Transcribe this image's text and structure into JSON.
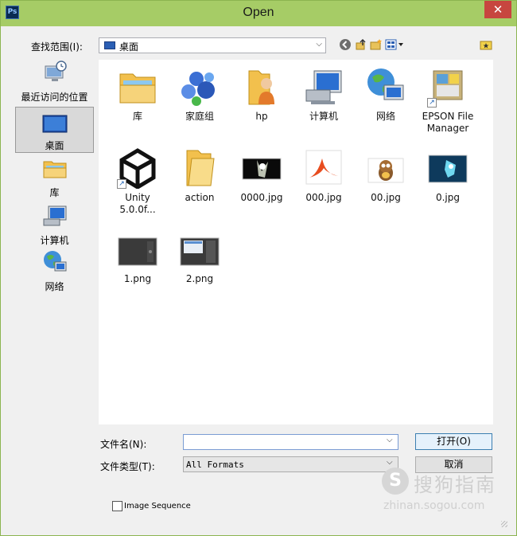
{
  "window": {
    "title": "Open",
    "app_icon": "Ps",
    "close_glyph": "✕"
  },
  "lookin": {
    "label": "查找范围(I):",
    "value": "桌面"
  },
  "sidebar": {
    "items": [
      {
        "label": "最近访问的位置",
        "icon": "recent-places-icon"
      },
      {
        "label": "桌面",
        "icon": "desktop-icon",
        "selected": true
      },
      {
        "label": "库",
        "icon": "libraries-icon"
      },
      {
        "label": "计算机",
        "icon": "computer-icon"
      },
      {
        "label": "网络",
        "icon": "network-icon"
      }
    ]
  },
  "files": [
    {
      "name": "库",
      "icon": "libraries-icon"
    },
    {
      "name": "家庭组",
      "icon": "homegroup-icon"
    },
    {
      "name": "hp",
      "icon": "user-folder-icon"
    },
    {
      "name": "计算机",
      "icon": "computer-icon"
    },
    {
      "name": "网络",
      "icon": "network-icon"
    },
    {
      "name": "EPSON File Manager",
      "icon": "epson-shortcut-icon"
    },
    {
      "name": "Unity 5.0.0f...",
      "icon": "unity-shortcut-icon"
    },
    {
      "name": "action",
      "icon": "folder-icon"
    },
    {
      "name": "0000.jpg",
      "icon": "image-thumbnail"
    },
    {
      "name": "000.jpg",
      "icon": "image-thumbnail"
    },
    {
      "name": "00.jpg",
      "icon": "image-thumbnail"
    },
    {
      "name": "0.jpg",
      "icon": "image-thumbnail"
    },
    {
      "name": "1.png",
      "icon": "image-thumbnail"
    },
    {
      "name": "2.png",
      "icon": "image-thumbnail"
    }
  ],
  "form": {
    "filename_label": "文件名(N):",
    "filename_value": "",
    "filetype_label": "文件类型(T):",
    "filetype_value": "All Formats",
    "open_label": "打开(O)",
    "cancel_label": "取消",
    "image_sequence_label": "Image Sequence",
    "image_sequence_checked": false
  },
  "watermark": {
    "brand": "搜狗指南",
    "url": "zhinan.sogou.com"
  },
  "colors": {
    "titlebar": "#a6cc66",
    "close": "#c7463f"
  }
}
